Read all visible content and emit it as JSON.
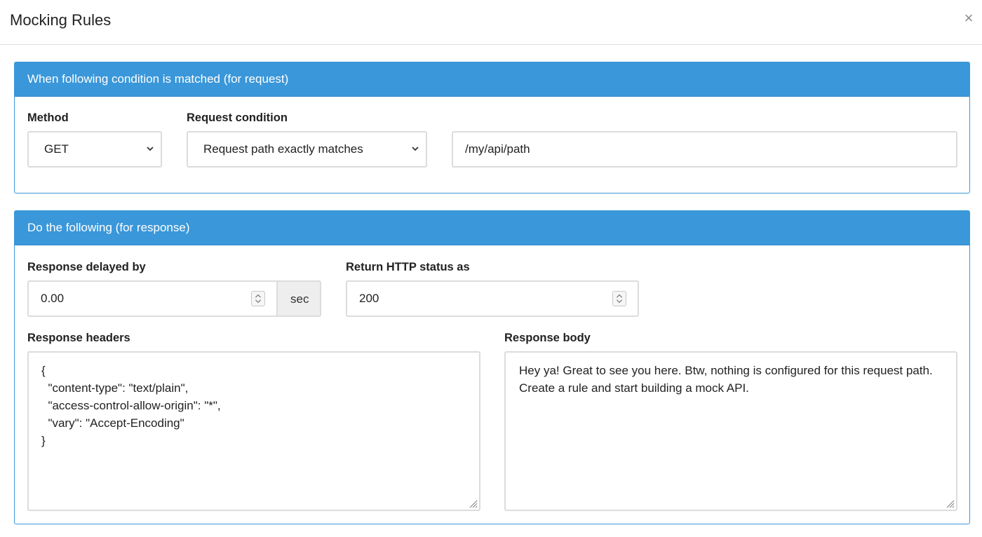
{
  "modal": {
    "title": "Mocking Rules",
    "close_icon": "close-icon",
    "close_glyph": "×"
  },
  "request_panel": {
    "heading": "When following condition is matched (for request)",
    "method": {
      "label": "Method",
      "value": "GET"
    },
    "condition": {
      "label": "Request condition",
      "value": "Request path exactly matches"
    },
    "path": {
      "value": "/my/api/path"
    }
  },
  "response_panel": {
    "heading": "Do the following (for response)",
    "delay": {
      "label": "Response delayed by",
      "value": "0.00",
      "unit": "sec"
    },
    "status": {
      "label": "Return HTTP status as",
      "value": "200"
    },
    "headers": {
      "label": "Response headers",
      "lines": [
        "{",
        "  \"content-type\": \"text/plain\",",
        "  \"access-control-allow-origin\": \"*\",",
        "  \"vary\": \"Accept-Encoding\"",
        "}"
      ]
    },
    "body": {
      "label": "Response body",
      "lines": [
        "Hey ya! Great to see you here. Btw, nothing is configured for this request path.",
        "Create a rule and start building a mock API."
      ]
    }
  },
  "colors": {
    "panel_accent": "#3a97d9",
    "border": "#dcdcdc"
  }
}
